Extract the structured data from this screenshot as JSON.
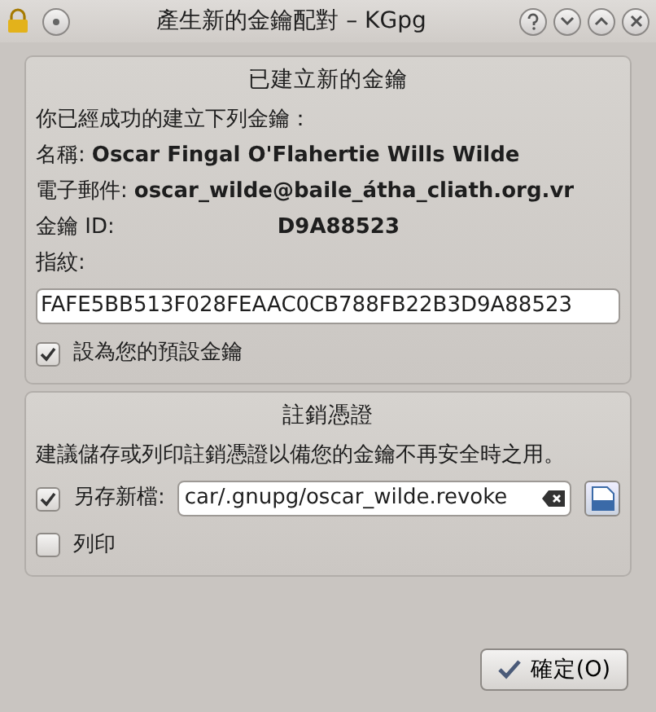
{
  "window": {
    "title": "產生新的金鑰配對 – KGpg"
  },
  "created_group": {
    "title": "已建立新的金鑰",
    "intro": "你已經成功的建立下列金鑰：",
    "fields": [
      {
        "label": "名稱:",
        "value": "Oscar Fingal O'Flahertie Wills Wilde"
      },
      {
        "label": "電子郵件:",
        "value": "oscar_wilde@baile_átha_cliath.org.vr"
      },
      {
        "label": "金鑰 ID:",
        "value": "D9A88523"
      }
    ],
    "fingerprint_label": "指紋:",
    "fingerprint": "FAFE5BB513F028FEAAC0CB788FB22B3D9A88523",
    "default_key": {
      "label": "設為您的預設金鑰",
      "checked": true
    }
  },
  "revoke_group": {
    "title": "註銷憑證",
    "hint": "建議儲存或列印註銷憑證以備您的金鑰不再安全時之用。",
    "save": {
      "label": "另存新檔:",
      "checked": true,
      "path": "car/.gnupg/oscar_wilde.revoke"
    },
    "print": {
      "label": "列印",
      "checked": false
    }
  },
  "ok_button": "確定(O)"
}
